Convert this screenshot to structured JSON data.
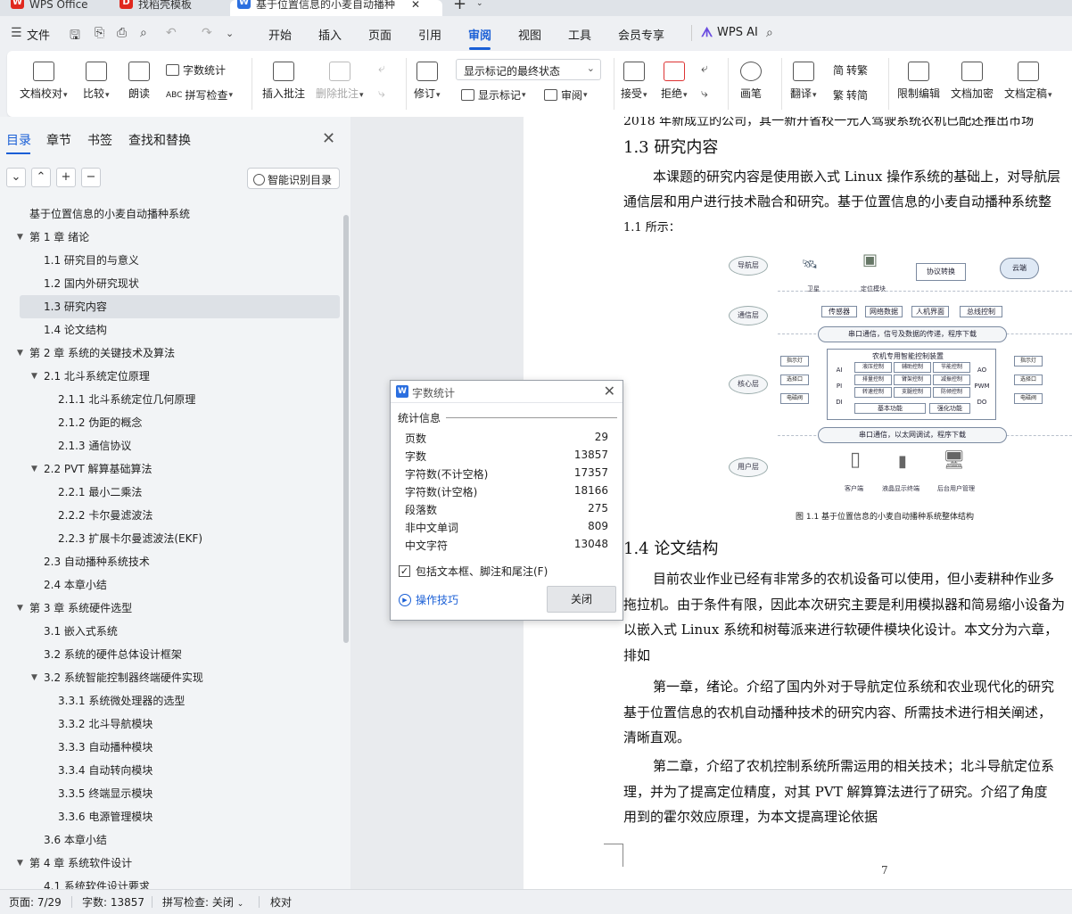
{
  "tabs": [
    {
      "label": "WPS Office",
      "icon": "wps-logo-icon",
      "color": "#e0281e"
    },
    {
      "label": "找稻壳模板",
      "icon": "docer-icon",
      "color": "#e0281e"
    },
    {
      "label": "基于位置信息的小麦自动播种",
      "icon": "word-doc-icon",
      "color": "#2b6fe0"
    }
  ],
  "menu": {
    "file": "文件",
    "items": [
      "开始",
      "插入",
      "页面",
      "引用",
      "审阅",
      "视图",
      "工具",
      "会员专享"
    ],
    "active": "审阅",
    "wps_ai": "WPS AI"
  },
  "ribbon": {
    "doc_proofread": "文档校对",
    "compare": "比较",
    "read_aloud": "朗读",
    "word_count": "字数统计",
    "spell_check": "拼写检查",
    "insert_comment": "插入批注",
    "delete_comment": "删除批注",
    "track_changes": "修订",
    "markup_select": "显示标记的最终状态",
    "show_markup": "显示标记",
    "review": "审阅",
    "accept": "接受",
    "reject": "拒绝",
    "pen": "画笔",
    "translate": "翻译",
    "to_traditional": "转繁",
    "to_simplified": "转简",
    "restrict_edit": "限制编辑",
    "doc_encrypt": "文档加密",
    "doc_finalize": "文档定稿"
  },
  "nav": {
    "tabs": [
      "目录",
      "章节",
      "书签",
      "查找和替换"
    ],
    "smart_toc": "智能识别目录",
    "toc": [
      {
        "label": "基于位置信息的小麦自动播种系统",
        "level": 0,
        "expand": false
      },
      {
        "label": "第 1 章  绪论",
        "level": 0,
        "expand": true
      },
      {
        "label": "1.1  研究目的与意义",
        "level": 1,
        "expand": false
      },
      {
        "label": "1.2  国内外研究现状",
        "level": 1,
        "expand": false
      },
      {
        "label": "1.3  研究内容",
        "level": 1,
        "expand": false,
        "selected": true
      },
      {
        "label": "1.4  论文结构",
        "level": 1,
        "expand": false
      },
      {
        "label": "第 2 章  系统的关键技术及算法",
        "level": 0,
        "expand": true
      },
      {
        "label": "2.1  北斗系统定位原理",
        "level": 1,
        "expand": true
      },
      {
        "label": "2.1.1  北斗系统定位几何原理",
        "level": 2,
        "expand": false
      },
      {
        "label": "2.1.2  伪距的概念",
        "level": 2,
        "expand": false
      },
      {
        "label": "2.1.3  通信协议",
        "level": 2,
        "expand": false
      },
      {
        "label": "2.2    PVT 解算基础算法",
        "level": 1,
        "expand": true
      },
      {
        "label": "2.2.1  最小二乘法",
        "level": 2,
        "expand": false
      },
      {
        "label": "2.2.2  卡尔曼滤波法",
        "level": 2,
        "expand": false
      },
      {
        "label": "2.2.3  扩展卡尔曼滤波法(EKF)",
        "level": 2,
        "expand": false
      },
      {
        "label": "2.3  自动播种系统技术",
        "level": 1,
        "expand": false
      },
      {
        "label": "2.4  本章小结",
        "level": 1,
        "expand": false
      },
      {
        "label": "第 3 章  系统硬件选型",
        "level": 0,
        "expand": true
      },
      {
        "label": "3.1  嵌入式系统",
        "level": 1,
        "expand": false
      },
      {
        "label": "3.2  系统的硬件总体设计框架",
        "level": 1,
        "expand": false
      },
      {
        "label": "3.2  系统智能控制器终端硬件实现",
        "level": 1,
        "expand": true
      },
      {
        "label": "3.3.1  系统微处理器的选型",
        "level": 2,
        "expand": false
      },
      {
        "label": "3.3.2  北斗导航模块",
        "level": 2,
        "expand": false
      },
      {
        "label": "3.3.3  自动播种模块",
        "level": 2,
        "expand": false
      },
      {
        "label": "3.3.4  自动转向模块",
        "level": 2,
        "expand": false
      },
      {
        "label": "3.3.5  终端显示模块",
        "level": 2,
        "expand": false
      },
      {
        "label": "3.3.6  电源管理模块",
        "level": 2,
        "expand": false
      },
      {
        "label": "3.6  本章小结",
        "level": 1,
        "expand": false
      },
      {
        "label": "第 4 章  系统软件设计",
        "level": 0,
        "expand": true
      },
      {
        "label": "4.1  系统软件设计要求",
        "level": 1,
        "expand": false
      }
    ]
  },
  "doc": {
    "cut_line": "2018 年新成立的公司，其一新开省校一元人驾驶系统农机已配还推出市场",
    "h_13": "1.3  研究内容",
    "p1": [
      "本课题的研究内容是使用嵌入式 Linux 操作系统的基础上，对导航层",
      "通信层和用户进行技术融合和研究。基于位置信息的小麦自动播种系统整",
      "1.1 所示："
    ],
    "figure": {
      "layers": [
        "导航层",
        "通信层",
        "核心层",
        "用户层"
      ],
      "nav_items": [
        "卫星",
        "定位模块",
        "协议转换",
        "云端"
      ],
      "comm_items": [
        "传感器",
        "网络数据",
        "人机界面",
        "总线控制"
      ],
      "bar1": "串口通信，信号及数据的传递，程序下载",
      "core_title": "农机专用智能控制装置",
      "core_left": [
        "AI",
        "PI",
        "DI"
      ],
      "core_right": [
        "AO",
        "PWM",
        "DO"
      ],
      "core_cells": [
        "液压控制",
        "辅助控制",
        "节能控制",
        "排量控制",
        "臂架控制",
        "减振控制",
        "转速控制",
        "支腿控制",
        "防倾控制"
      ],
      "core_bottom": [
        "基本功能",
        "强化功能"
      ],
      "side_left": [
        "指示灯",
        "选择口",
        "电磁阀"
      ],
      "side_right": [
        "指示灯",
        "选择口",
        "电磁阀"
      ],
      "bar2": "串口通信，以太网调试，程序下载",
      "user_items": [
        "客户端",
        "液晶显示终端",
        "后台用户管理"
      ]
    },
    "fig_caption": "图 1.1 基于位置信息的小麦自动播种系统整体结构",
    "h_14": "1.4  论文结构",
    "p2": [
      "目前农业作业已经有非常多的农机设备可以使用，但小麦耕种作业多",
      "拖拉机。由于条件有限，因此本次研究主要是利用模拟器和简易缩小设备为",
      "以嵌入式 Linux 系统和树莓派来进行软硬件模块化设计。本文分为六章，",
      "排如"
    ],
    "p3": [
      "第一章，绪论。介绍了国内外对于导航定位系统和农业现代化的研究",
      "基于位置信息的农机自动播种技术的研究内容、所需技术进行相关阐述，",
      "清晰直观。"
    ],
    "p4": [
      "第二章，介绍了农机控制系统所需运用的相关技术；北斗导航定位系",
      "理，并为了提高定位精度，对其 PVT 解算算法进行了研究。介绍了角度",
      "用到的霍尔效应原理，为本文提高理论依据"
    ],
    "page_number": "7"
  },
  "dialog": {
    "title": "字数统计",
    "section": "统计信息",
    "stats": [
      {
        "label": "页数",
        "value": "29"
      },
      {
        "label": "字数",
        "value": "13857"
      },
      {
        "label": "字符数(不计空格)",
        "value": "17357"
      },
      {
        "label": "字符数(计空格)",
        "value": "18166"
      },
      {
        "label": "段落数",
        "value": "275"
      },
      {
        "label": "非中文单词",
        "value": "809"
      },
      {
        "label": "中文字符",
        "value": "13048"
      }
    ],
    "include_checkbox": "包括文本框、脚注和尾注(F)",
    "include_checked": true,
    "tips": "操作技巧",
    "close": "关闭"
  },
  "status": {
    "page": "页面: 7/29",
    "words": "字数: 13857",
    "spell": "拼写检查: 关闭",
    "proof": "校对"
  },
  "colors": {
    "accent": "#1a5fd6",
    "wps_red": "#e0281e",
    "word_blue": "#2b6fe0"
  }
}
